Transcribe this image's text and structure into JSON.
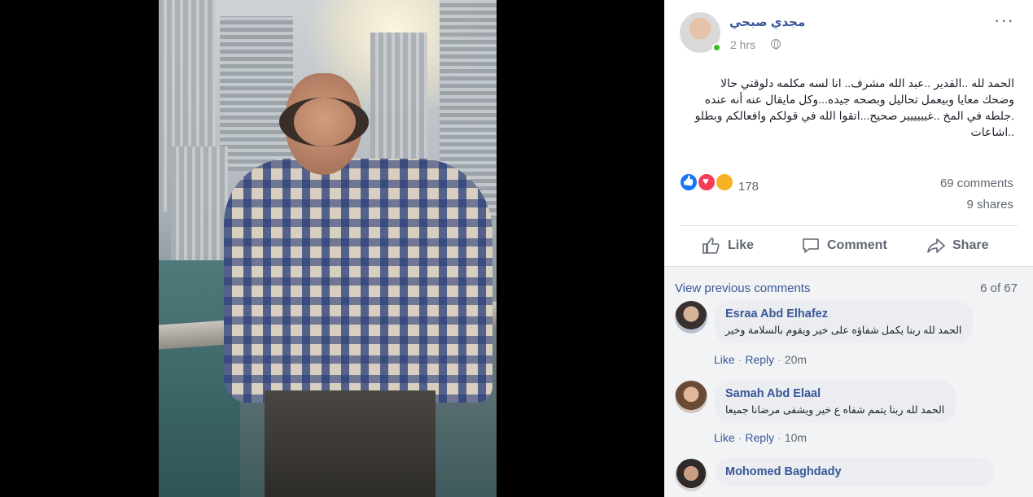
{
  "post": {
    "author": "مجدي صبحي",
    "time": "2 hrs",
    "text": "الحمد لله ..القدير ..عبد الله مشرف.. انا لسه مكلمه دلوقتي حالا وضحك معايا وبيعمل تحاليل وبصحه جيده...وكل مايقال عنه أنه عنده .جلطه في المخ ..غيييييير صحيح...اتقوا الله في قولكم وافعالكم وبطلو ..اشاعات",
    "reaction_count": "178",
    "comments_count": "69 comments",
    "shares_count": "9 shares",
    "reactions": [
      "like-icon",
      "love-icon",
      "care-icon"
    ]
  },
  "actions": {
    "like": "Like",
    "comment": "Comment",
    "share": "Share"
  },
  "comments_section": {
    "view_previous": "View previous comments",
    "page_count": "6 of 67",
    "items": [
      {
        "name": "Esraa Abd Elhafez",
        "text": "الحمد لله ربنا يكمل شفاؤه على خير ويقوم بالسلامة وخير",
        "like": "Like",
        "reply": "Reply",
        "ago": "20m"
      },
      {
        "name": "Samah Abd Elaal",
        "text": "الحمد لله ربنا يتمم شفاه ع خير ويشفى مرضانا جميعا",
        "like": "Like",
        "reply": "Reply",
        "ago": "10m"
      },
      {
        "name": "Mohomed Baghdady"
      }
    ]
  },
  "colors": {
    "link": "#385898",
    "online": "#42b72a",
    "like_blue": "#1877f2",
    "love_red": "#f33e58"
  }
}
